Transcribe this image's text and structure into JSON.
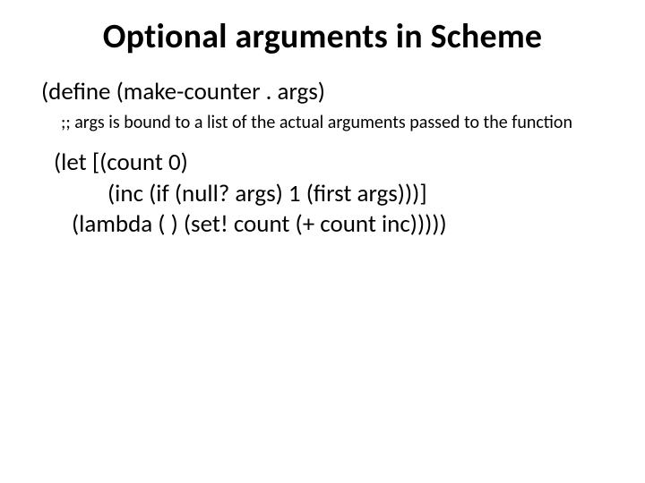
{
  "title": "Optional arguments in Scheme",
  "define_line": "(define (make-counter . args)",
  "comment": ";; args is bound to a list of the actual arguments passed to the function",
  "code_let": "(let [(count 0)",
  "code_inc": "(inc (if (null? args) 1 (first args)))]",
  "code_lambda": "(lambda ( ) (set! count (+ count inc)))))"
}
